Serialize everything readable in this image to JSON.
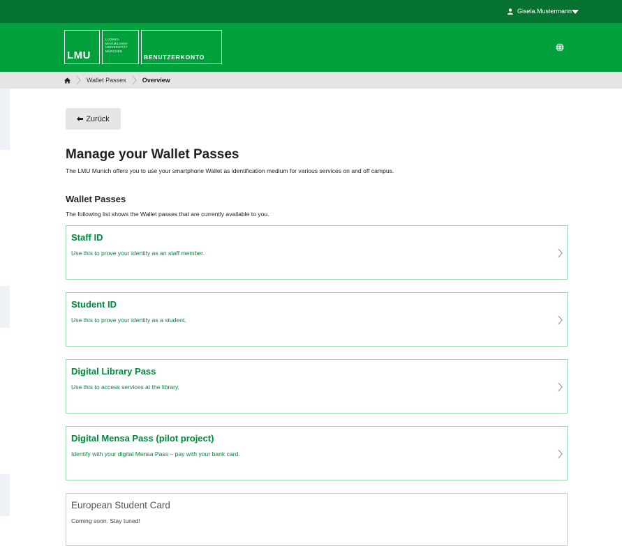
{
  "topbar": {
    "username": "Gisela.Mustermann"
  },
  "header": {
    "logo_text": "LMU",
    "university_lines": [
      "LUDWIG-",
      "MAXIMILIANS-",
      "UNIVERSITÄT",
      "MÜNCHEN"
    ],
    "app_name": "BENUTZERKONTO"
  },
  "breadcrumb": {
    "items": [
      "Wallet Passes",
      "Overview"
    ]
  },
  "back_button": {
    "label": "Zurück"
  },
  "page": {
    "title": "Manage your Wallet Passes",
    "intro": "The LMU Munich offers you to use your smartphone Wallet as identification medium for various services on and off campus."
  },
  "wallet_section": {
    "title": "Wallet Passes",
    "subtitle": "The following list shows the Wallet passes that are currently available to you.",
    "passes": [
      {
        "title": "Staff ID",
        "description": "Use this to prove your identity as an staff member."
      },
      {
        "title": "Student ID",
        "description": "Use this to prove your identity as a student."
      },
      {
        "title": "Digital Library Pass",
        "description": "Use this to access services at the library."
      },
      {
        "title": "Digital Mensa Pass (pilot project)",
        "description": "Identify with your digital Mensa Pass – pay with your bank card."
      },
      {
        "title": "European Student Card",
        "description": "Coming soon. Stay tuned!"
      }
    ]
  },
  "colors": {
    "topbar": "#05722f",
    "header": "#00a03c",
    "accent_text": "#00883a",
    "card_border": "#9ad6ad",
    "breadcrumb_bg": "#e5e5e5"
  }
}
